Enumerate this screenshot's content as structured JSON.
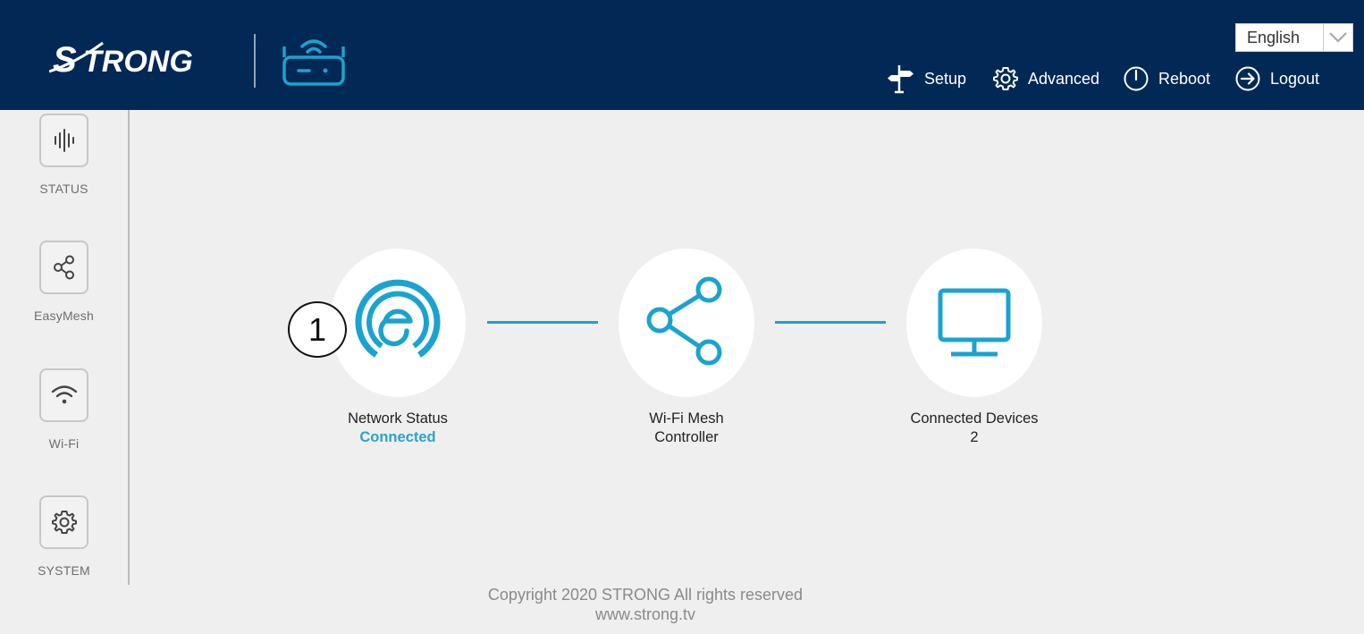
{
  "header": {
    "logo_text": "STRONG",
    "language": {
      "selected": "English"
    },
    "nav": [
      {
        "label": "Setup",
        "icon": "signpost-icon"
      },
      {
        "label": "Advanced",
        "icon": "gear-icon"
      },
      {
        "label": "Reboot",
        "icon": "power-icon"
      },
      {
        "label": "Logout",
        "icon": "logout-icon"
      }
    ]
  },
  "sidebar": {
    "items": [
      {
        "label": "STATUS",
        "icon": "activity-icon"
      },
      {
        "label": "EasyMesh",
        "icon": "share-icon"
      },
      {
        "label": "Wi-Fi",
        "icon": "wifi-icon"
      },
      {
        "label": "SYSTEM",
        "icon": "gear-icon"
      }
    ]
  },
  "diagram": {
    "callout": "1",
    "nodes": [
      {
        "line1": "Network Status",
        "line2": "Connected",
        "icon": "easymesh-logo-icon"
      },
      {
        "line1": "Wi-Fi Mesh",
        "line2": "Controller",
        "icon": "share-icon"
      },
      {
        "line1": "Connected Devices",
        "line2": "2",
        "icon": "monitor-icon"
      }
    ]
  },
  "footer": {
    "copyright": "Copyright 2020 STRONG All rights reserved",
    "website": "www.strong.tv"
  },
  "colors": {
    "header_bg": "#022856",
    "accent": "#1ba3cf",
    "page_bg": "#efefef"
  }
}
